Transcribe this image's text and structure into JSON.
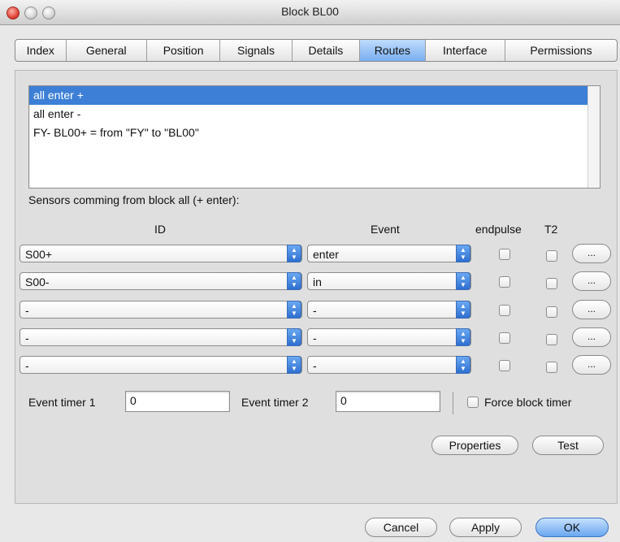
{
  "window": {
    "title": "Block BL00"
  },
  "tabs": [
    {
      "label": "Index"
    },
    {
      "label": "General"
    },
    {
      "label": "Position"
    },
    {
      "label": "Signals"
    },
    {
      "label": "Details"
    },
    {
      "label": "Routes"
    },
    {
      "label": "Interface"
    },
    {
      "label": "Permissions"
    }
  ],
  "active_tab": "Routes",
  "routes_list": [
    {
      "label": "all enter +",
      "selected": true
    },
    {
      "label": "all enter -"
    },
    {
      "label": "FY- BL00+ = from \"FY\" to \"BL00\""
    }
  ],
  "sensors_label": "Sensors comming from block all (+ enter):",
  "columns": {
    "id": "ID",
    "event": "Event",
    "endpulse": "endpulse",
    "t2": "T2"
  },
  "sensor_rows": [
    {
      "id": "S00+",
      "event": "enter",
      "endpulse": false,
      "t2": false,
      "more": "..."
    },
    {
      "id": "S00-",
      "event": "in",
      "endpulse": false,
      "t2": false,
      "more": "..."
    },
    {
      "id": "-",
      "event": "-",
      "endpulse": false,
      "t2": false,
      "more": "..."
    },
    {
      "id": "-",
      "event": "-",
      "endpulse": false,
      "t2": false,
      "more": "..."
    },
    {
      "id": "-",
      "event": "-",
      "endpulse": false,
      "t2": false,
      "more": "..."
    }
  ],
  "timers": {
    "timer1_label": "Event timer 1",
    "timer1_value": "0",
    "timer2_label": "Event timer 2",
    "timer2_value": "0",
    "force_label": "Force block timer",
    "force_checked": false
  },
  "actions": {
    "properties": "Properties",
    "test": "Test"
  },
  "footer": {
    "cancel": "Cancel",
    "apply": "Apply",
    "ok": "OK"
  }
}
